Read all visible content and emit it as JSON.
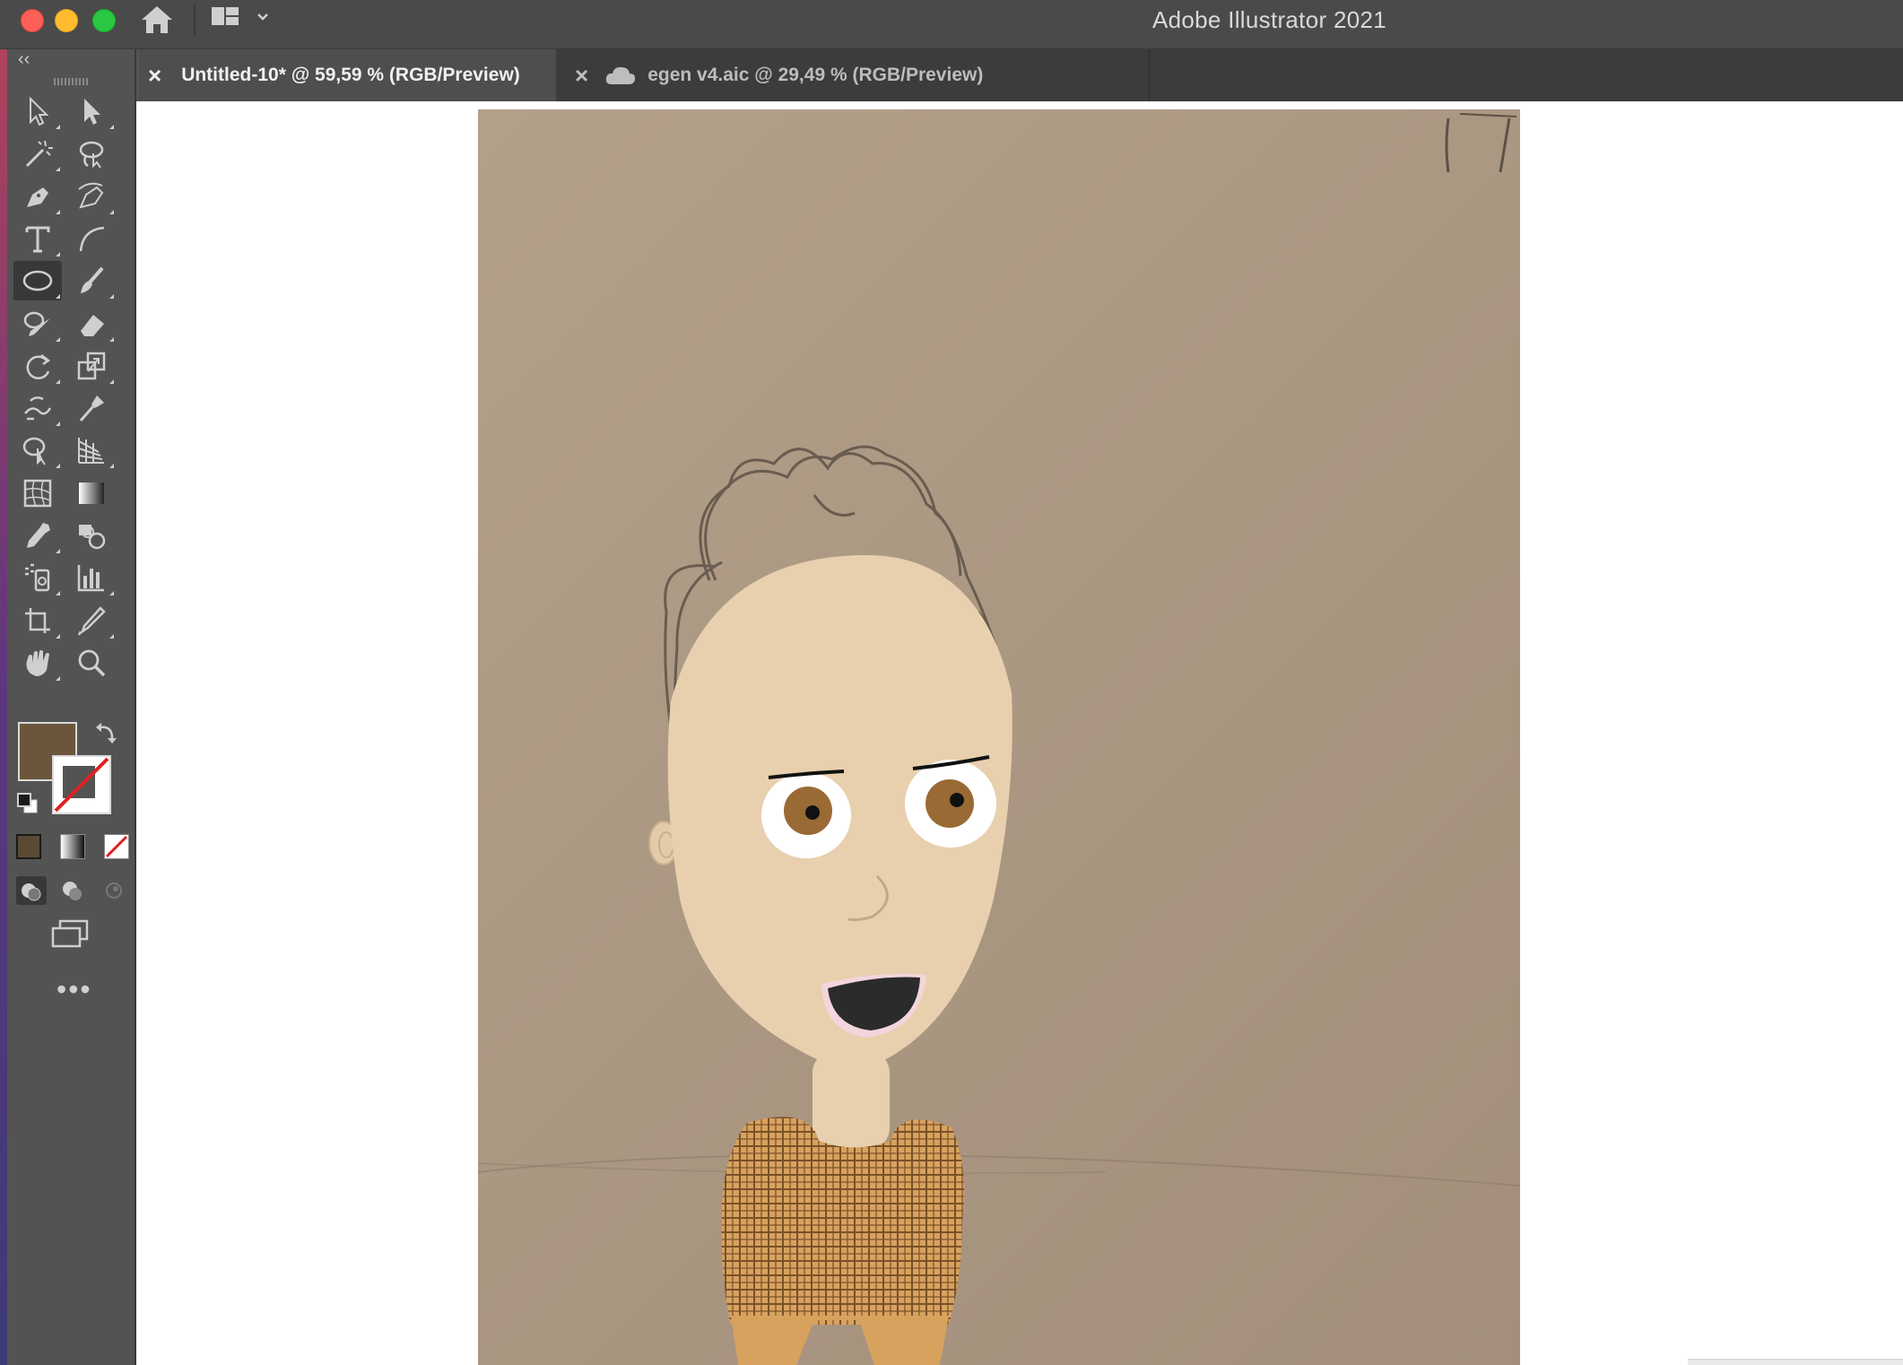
{
  "window": {
    "title": "Adobe Illustrator 2021"
  },
  "tabs": [
    {
      "label": "Untitled-10* @ 59,59 % (RGB/Preview)",
      "close": "×",
      "active": true
    },
    {
      "label": "egen v4.aic @ 29,49 % (RGB/Preview)",
      "close": "×",
      "active": false,
      "icon": "cloud-icon"
    }
  ],
  "toolbar": {
    "collapse": "‹‹",
    "more": "•••",
    "tools": [
      "selection-tool",
      "direct-selection-tool",
      "magic-wand-tool",
      "lasso-tool",
      "pen-tool",
      "curvature-tool",
      "type-tool",
      "arc-tool",
      "ellipse-tool",
      "paintbrush-tool",
      "blob-brush-tool",
      "eraser-tool",
      "rotate-tool",
      "scale-tool",
      "warp-tool",
      "puppet-warp-tool",
      "shape-builder-tool",
      "perspective-grid-tool",
      "mesh-tool",
      "gradient-tool",
      "eyedropper-tool",
      "blend-tool",
      "symbol-sprayer-tool",
      "column-graph-tool",
      "artboard-tool",
      "slice-tool",
      "hand-tool",
      "zoom-tool"
    ],
    "active_tool": "ellipse-tool",
    "fill_color": "#6b563b",
    "stroke_color": "none"
  },
  "colors": {
    "accent_close": "#fe5f57",
    "accent_min": "#febc2e",
    "accent_max": "#28c840",
    "skin": "#e8d0ae",
    "shirt": "#d7a25e",
    "eye_iris": "#9a6a35"
  }
}
